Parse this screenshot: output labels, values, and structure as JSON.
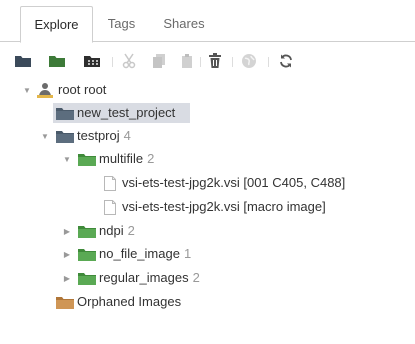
{
  "tabs": [
    {
      "label": "Explore",
      "active": true
    },
    {
      "label": "Tags",
      "active": false
    },
    {
      "label": "Shares",
      "active": false
    }
  ],
  "toolbar": {
    "icons": [
      "new-project-icon",
      "new-dataset-icon",
      "new-screen-icon",
      "cut-icon",
      "copy-icon",
      "paste-icon",
      "delete-icon",
      "publish-icon",
      "refresh-icon"
    ]
  },
  "tree": {
    "root": {
      "label": "root root"
    },
    "new_test_project": {
      "label": "new_test_project"
    },
    "testproj": {
      "label": "testproj",
      "count": "4"
    },
    "multifile": {
      "label": "multifile",
      "count": "2"
    },
    "image1": {
      "label": "vsi-ets-test-jpg2k.vsi [001 C405, C488]"
    },
    "image2": {
      "label": "vsi-ets-test-jpg2k.vsi [macro image]"
    },
    "ndpi": {
      "label": "ndpi",
      "count": "2"
    },
    "no_file_image": {
      "label": "no_file_image",
      "count": "1"
    },
    "regular_images": {
      "label": "regular_images",
      "count": "2"
    },
    "orphaned": {
      "label": "Orphaned Images"
    }
  },
  "colors": {
    "project_folder": "#4a5a6a",
    "dataset_folder": "#4f9a4a",
    "orphaned_folder": "#c58a4a",
    "selection": "#d9dce3"
  }
}
